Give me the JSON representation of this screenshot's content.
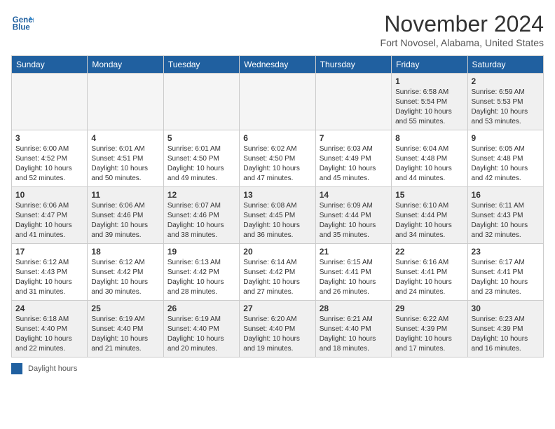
{
  "header": {
    "logo_line1": "General",
    "logo_line2": "Blue",
    "month_title": "November 2024",
    "location": "Fort Novosel, Alabama, United States"
  },
  "days_of_week": [
    "Sunday",
    "Monday",
    "Tuesday",
    "Wednesday",
    "Thursday",
    "Friday",
    "Saturday"
  ],
  "weeks": [
    [
      {
        "day": "",
        "info": "",
        "empty": true
      },
      {
        "day": "",
        "info": "",
        "empty": true
      },
      {
        "day": "",
        "info": "",
        "empty": true
      },
      {
        "day": "",
        "info": "",
        "empty": true
      },
      {
        "day": "",
        "info": "",
        "empty": true
      },
      {
        "day": "1",
        "info": "Sunrise: 6:58 AM\nSunset: 5:54 PM\nDaylight: 10 hours\nand 55 minutes."
      },
      {
        "day": "2",
        "info": "Sunrise: 6:59 AM\nSunset: 5:53 PM\nDaylight: 10 hours\nand 53 minutes."
      }
    ],
    [
      {
        "day": "3",
        "info": "Sunrise: 6:00 AM\nSunset: 4:52 PM\nDaylight: 10 hours\nand 52 minutes."
      },
      {
        "day": "4",
        "info": "Sunrise: 6:01 AM\nSunset: 4:51 PM\nDaylight: 10 hours\nand 50 minutes."
      },
      {
        "day": "5",
        "info": "Sunrise: 6:01 AM\nSunset: 4:50 PM\nDaylight: 10 hours\nand 49 minutes."
      },
      {
        "day": "6",
        "info": "Sunrise: 6:02 AM\nSunset: 4:50 PM\nDaylight: 10 hours\nand 47 minutes."
      },
      {
        "day": "7",
        "info": "Sunrise: 6:03 AM\nSunset: 4:49 PM\nDaylight: 10 hours\nand 45 minutes."
      },
      {
        "day": "8",
        "info": "Sunrise: 6:04 AM\nSunset: 4:48 PM\nDaylight: 10 hours\nand 44 minutes."
      },
      {
        "day": "9",
        "info": "Sunrise: 6:05 AM\nSunset: 4:48 PM\nDaylight: 10 hours\nand 42 minutes."
      }
    ],
    [
      {
        "day": "10",
        "info": "Sunrise: 6:06 AM\nSunset: 4:47 PM\nDaylight: 10 hours\nand 41 minutes."
      },
      {
        "day": "11",
        "info": "Sunrise: 6:06 AM\nSunset: 4:46 PM\nDaylight: 10 hours\nand 39 minutes."
      },
      {
        "day": "12",
        "info": "Sunrise: 6:07 AM\nSunset: 4:46 PM\nDaylight: 10 hours\nand 38 minutes."
      },
      {
        "day": "13",
        "info": "Sunrise: 6:08 AM\nSunset: 4:45 PM\nDaylight: 10 hours\nand 36 minutes."
      },
      {
        "day": "14",
        "info": "Sunrise: 6:09 AM\nSunset: 4:44 PM\nDaylight: 10 hours\nand 35 minutes."
      },
      {
        "day": "15",
        "info": "Sunrise: 6:10 AM\nSunset: 4:44 PM\nDaylight: 10 hours\nand 34 minutes."
      },
      {
        "day": "16",
        "info": "Sunrise: 6:11 AM\nSunset: 4:43 PM\nDaylight: 10 hours\nand 32 minutes."
      }
    ],
    [
      {
        "day": "17",
        "info": "Sunrise: 6:12 AM\nSunset: 4:43 PM\nDaylight: 10 hours\nand 31 minutes."
      },
      {
        "day": "18",
        "info": "Sunrise: 6:12 AM\nSunset: 4:42 PM\nDaylight: 10 hours\nand 30 minutes."
      },
      {
        "day": "19",
        "info": "Sunrise: 6:13 AM\nSunset: 4:42 PM\nDaylight: 10 hours\nand 28 minutes."
      },
      {
        "day": "20",
        "info": "Sunrise: 6:14 AM\nSunset: 4:42 PM\nDaylight: 10 hours\nand 27 minutes."
      },
      {
        "day": "21",
        "info": "Sunrise: 6:15 AM\nSunset: 4:41 PM\nDaylight: 10 hours\nand 26 minutes."
      },
      {
        "day": "22",
        "info": "Sunrise: 6:16 AM\nSunset: 4:41 PM\nDaylight: 10 hours\nand 24 minutes."
      },
      {
        "day": "23",
        "info": "Sunrise: 6:17 AM\nSunset: 4:41 PM\nDaylight: 10 hours\nand 23 minutes."
      }
    ],
    [
      {
        "day": "24",
        "info": "Sunrise: 6:18 AM\nSunset: 4:40 PM\nDaylight: 10 hours\nand 22 minutes."
      },
      {
        "day": "25",
        "info": "Sunrise: 6:19 AM\nSunset: 4:40 PM\nDaylight: 10 hours\nand 21 minutes."
      },
      {
        "day": "26",
        "info": "Sunrise: 6:19 AM\nSunset: 4:40 PM\nDaylight: 10 hours\nand 20 minutes."
      },
      {
        "day": "27",
        "info": "Sunrise: 6:20 AM\nSunset: 4:40 PM\nDaylight: 10 hours\nand 19 minutes."
      },
      {
        "day": "28",
        "info": "Sunrise: 6:21 AM\nSunset: 4:40 PM\nDaylight: 10 hours\nand 18 minutes."
      },
      {
        "day": "29",
        "info": "Sunrise: 6:22 AM\nSunset: 4:39 PM\nDaylight: 10 hours\nand 17 minutes."
      },
      {
        "day": "30",
        "info": "Sunrise: 6:23 AM\nSunset: 4:39 PM\nDaylight: 10 hours\nand 16 minutes."
      }
    ]
  ],
  "footer": {
    "legend_label": "Daylight hours"
  }
}
